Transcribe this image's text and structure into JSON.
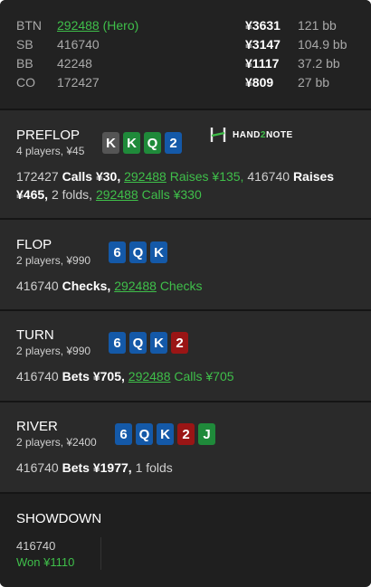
{
  "colors": {
    "accent_green": "#3fbf4a",
    "card_king": "#555555",
    "card_clubs": "#1f8a3a",
    "card_diamonds": "#1459a8",
    "card_hearts": "#9a1515"
  },
  "players": [
    {
      "pos": "BTN",
      "name": "292488",
      "tag": "(Hero)",
      "stack": "¥3631",
      "bb": "121 bb"
    },
    {
      "pos": "SB",
      "name": "416740",
      "tag": "",
      "stack": "¥3147",
      "bb": "104.9 bb"
    },
    {
      "pos": "BB",
      "name": "42248",
      "tag": "",
      "stack": "¥1117",
      "bb": "37.2 bb"
    },
    {
      "pos": "CO",
      "name": "172427",
      "tag": "",
      "stack": "¥809",
      "bb": "27 bb"
    }
  ],
  "logo": {
    "icon": "hand2note-logo-icon",
    "text_a": "HAND",
    "text_b": "2",
    "text_c": "NOTE"
  },
  "streets": {
    "preflop": {
      "title": "PREFLOP",
      "sub": "4 players, ¥45",
      "cards": [
        {
          "rank": "K",
          "suit": "king"
        },
        {
          "rank": "K",
          "suit": "clubs"
        },
        {
          "rank": "Q",
          "suit": "clubs"
        },
        {
          "rank": "2",
          "suit": "diamonds"
        }
      ],
      "a1": "172427",
      "a2": "Calls ¥30,",
      "a3": "292488",
      "a4": "Raises ¥135,",
      "a5": "416740",
      "a6": "Raises ¥465,",
      "a7": "2 folds,",
      "a8": "292488",
      "a9": "Calls ¥330"
    },
    "flop": {
      "title": "FLOP",
      "sub": "2 players, ¥990",
      "cards": [
        {
          "rank": "6",
          "suit": "diamonds"
        },
        {
          "rank": "Q",
          "suit": "diamonds"
        },
        {
          "rank": "K",
          "suit": "diamonds"
        }
      ],
      "a1": "416740",
      "a2": "Checks,",
      "a3": "292488",
      "a4": "Checks"
    },
    "turn": {
      "title": "TURN",
      "sub": "2 players, ¥990",
      "cards": [
        {
          "rank": "6",
          "suit": "diamonds"
        },
        {
          "rank": "Q",
          "suit": "diamonds"
        },
        {
          "rank": "K",
          "suit": "diamonds"
        },
        {
          "rank": "2",
          "suit": "hearts"
        }
      ],
      "a1": "416740",
      "a2": "Bets ¥705,",
      "a3": "292488",
      "a4": "Calls ¥705"
    },
    "river": {
      "title": "RIVER",
      "sub": "2 players, ¥2400",
      "cards": [
        {
          "rank": "6",
          "suit": "diamonds"
        },
        {
          "rank": "Q",
          "suit": "diamonds"
        },
        {
          "rank": "K",
          "suit": "diamonds"
        },
        {
          "rank": "2",
          "suit": "hearts"
        },
        {
          "rank": "J",
          "suit": "clubs"
        }
      ],
      "a1": "416740",
      "a2": "Bets ¥1977,",
      "a3": "1 folds"
    }
  },
  "showdown": {
    "title": "SHOWDOWN",
    "name": "416740",
    "result": "Won ¥1110"
  }
}
